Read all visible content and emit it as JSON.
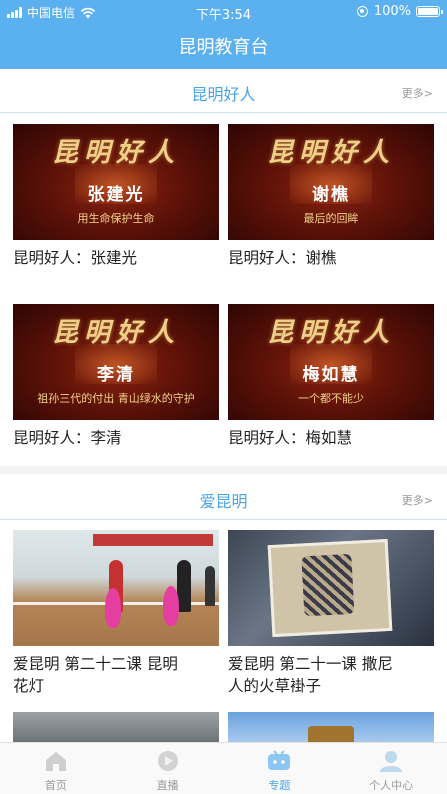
{
  "status_bar": {
    "carrier": "中国电信",
    "time": "下午3:54",
    "battery": "100%"
  },
  "header": {
    "title": "昆明教育台"
  },
  "sections": [
    {
      "title": "昆明好人",
      "more": "更多>",
      "items": [
        {
          "thumb_banner": "昆明好人",
          "thumb_name": "张建光",
          "thumb_tag": "用生命保护生命",
          "caption": "昆明好人：张建光"
        },
        {
          "thumb_banner": "昆明好人",
          "thumb_name": "谢樵",
          "thumb_tag": "最后的回眸",
          "caption": "昆明好人：谢樵"
        },
        {
          "thumb_banner": "昆明好人",
          "thumb_name": "李清",
          "thumb_tag": "祖孙三代的付出 青山绿水的守护",
          "caption": "昆明好人：李清"
        },
        {
          "thumb_banner": "昆明好人",
          "thumb_name": "梅如慧",
          "thumb_tag": "一个都不能少",
          "caption": "昆明好人：梅如慧"
        }
      ]
    },
    {
      "title": "爱昆明",
      "more": "更多>",
      "items": [
        {
          "caption_line1": "爱昆明  第二十二课  昆明",
          "caption_line2": "花灯"
        },
        {
          "caption_line1": "爱昆明  第二十一课 撒尼",
          "caption_line2": "人的火草褂子"
        }
      ]
    }
  ],
  "tabbar": {
    "tabs": [
      {
        "label": "首页",
        "icon": "home-icon"
      },
      {
        "label": "直播",
        "icon": "live-icon"
      },
      {
        "label": "专题",
        "icon": "topic-icon",
        "active": true
      },
      {
        "label": "个人中心",
        "icon": "user-icon"
      }
    ]
  },
  "colors": {
    "accent": "#5bb0f0",
    "section_title": "#4aa3e8"
  }
}
